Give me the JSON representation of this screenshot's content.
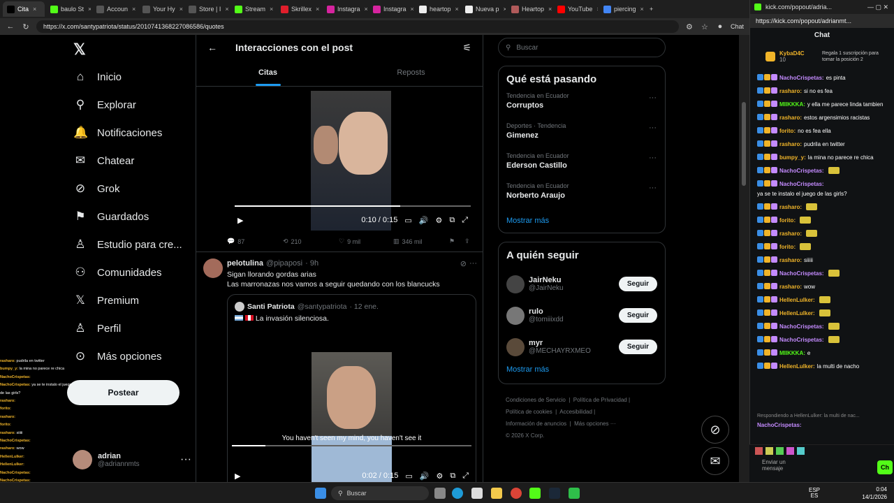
{
  "browser": {
    "tabs": [
      {
        "label": "Cita",
        "active": true,
        "color": "#000000"
      },
      {
        "label": "baulo St",
        "color": "#53fc18"
      },
      {
        "label": "Accoun",
        "color": "#555555"
      },
      {
        "label": "Your Hy",
        "color": "#555555"
      },
      {
        "label": "Store | I",
        "color": "#555555"
      },
      {
        "label": "Stream",
        "color": "#53fc18"
      },
      {
        "label": "Skrillex",
        "color": "#e01e2b"
      },
      {
        "label": "Instagra",
        "color": "#d6249f"
      },
      {
        "label": "Instagra",
        "color": "#d6249f"
      },
      {
        "label": "heartop",
        "color": "#eeeeee"
      },
      {
        "label": "Nueva p",
        "color": "#eeeeee"
      },
      {
        "label": "Heartop",
        "color": "#b05a5a"
      },
      {
        "label": "YouTube",
        "color": "#ff0000"
      },
      {
        "label": "piercing",
        "color": "#4285f4"
      }
    ],
    "url": "https://x.com/santypatriota/status/2010741368227086586/quotes",
    "profile_label": "Chat"
  },
  "x": {
    "nav": [
      {
        "label": "Inicio",
        "icon": "home-icon",
        "glyph": "⌂"
      },
      {
        "label": "Explorar",
        "icon": "search-icon",
        "glyph": "⚲"
      },
      {
        "label": "Notificaciones",
        "icon": "bell-icon",
        "glyph": "🔔"
      },
      {
        "label": "Chatear",
        "icon": "mail-icon",
        "glyph": "✉"
      },
      {
        "label": "Grok",
        "icon": "grok-icon",
        "glyph": "⊘"
      },
      {
        "label": "Guardados",
        "icon": "bookmark-icon",
        "glyph": "⚑"
      },
      {
        "label": "Estudio para cre...",
        "icon": "studio-icon",
        "glyph": "♙"
      },
      {
        "label": "Comunidades",
        "icon": "communities-icon",
        "glyph": "⚇"
      },
      {
        "label": "Premium",
        "icon": "premium-icon",
        "glyph": "𝕏"
      },
      {
        "label": "Perfil",
        "icon": "person-icon",
        "glyph": "♙"
      },
      {
        "label": "Más opciones",
        "icon": "more-icon",
        "glyph": "⊙"
      }
    ],
    "post_button": "Postear",
    "user": {
      "name": "adrian",
      "handle": "@adriannmts"
    },
    "header_title": "Interacciones con el post",
    "tabs": [
      "Citas",
      "Reposts"
    ],
    "video1": {
      "time": "0:10 / 0:15",
      "progress": 0.7
    },
    "post1_actions": {
      "replies": "87",
      "reposts": "210",
      "likes": "9 mil",
      "views": "346 mil"
    },
    "post2": {
      "name": "pelotulina",
      "handle": "@pipaposi",
      "age": "· 9h",
      "line1": "Sigan llorando gordas arias",
      "line2": "Las marronazas nos vamos a seguir quedando con los blancucks",
      "quoted": {
        "name": "Santi Patriota",
        "handle": "@santypatriota",
        "date": "· 12 ene.",
        "text": "La invasión silenciosa."
      },
      "subtitle": "You haven't seen my mind, you haven't see it",
      "video_time": "0:02 / 0:15",
      "progress": 0.14
    },
    "search_placeholder": "Buscar",
    "trends_title": "Qué está pasando",
    "trends": [
      {
        "context": "Tendencia en Ecuador",
        "name": "Corruptos"
      },
      {
        "context": "Deportes · Tendencia",
        "name": "Gimenez"
      },
      {
        "context": "Tendencia en Ecuador",
        "name": "Ederson Castillo"
      },
      {
        "context": "Tendencia en Ecuador",
        "name": "Norberto Araujo"
      }
    ],
    "show_more": "Mostrar más",
    "follow_title": "A quién seguir",
    "follow": [
      {
        "name": "JairNeku",
        "handle": "@JairNeku",
        "btn": "Seguir"
      },
      {
        "name": "rulo",
        "handle": "@tomiiixdd",
        "btn": "Seguir"
      },
      {
        "name": "myr",
        "handle": "@MECHAYRXMEO",
        "btn": "Seguir"
      }
    ],
    "footer": [
      "Condiciones de Servicio",
      "Política de Privacidad",
      "Política de cookies",
      "Accesibilidad",
      "Información de anuncios",
      "Más opciones ···",
      "© 2026 X Corp."
    ]
  },
  "overlay_chat": [
    {
      "user": "rasharo:",
      "text": "pudrila en twitter"
    },
    {
      "user": "bumpy_y:",
      "text": "la mina no parece re chica"
    },
    {
      "user": "NachoCrispetas:",
      "text": ""
    },
    {
      "user": "NachoCrispetas:",
      "text": "ya se te instalo el juego de las girls?"
    },
    {
      "user": "rasharo:",
      "text": ""
    },
    {
      "user": "forito:",
      "text": ""
    },
    {
      "user": "rasharo:",
      "text": ""
    },
    {
      "user": "forito:",
      "text": ""
    },
    {
      "user": "rasharo:",
      "text": "siiiii"
    },
    {
      "user": "NachoCrispetas:",
      "text": ""
    },
    {
      "user": "rasharo:",
      "text": "wow"
    },
    {
      "user": "HellenLulker:",
      "text": ""
    },
    {
      "user": "HellenLulker:",
      "text": ""
    },
    {
      "user": "NachoCrispetas:",
      "text": ""
    },
    {
      "user": "NachoCrispetas:",
      "text": ""
    },
    {
      "user": "MIIKKKA:",
      "text": "e"
    },
    {
      "user": "HellenLulker:",
      "text": "la multi de nacho"
    }
  ],
  "popout": {
    "url": "https://kick.com/popout/adrianmt...",
    "tab_label": "kick.com/popout/adria...",
    "title": "Chat",
    "pinned_user": "KybaD4C",
    "pinned_count": "10",
    "pinned_text": "Regala 1 suscripción para tomar la posición 2",
    "messages": [
      {
        "user": "NachoCrispetas:",
        "text": "es pinta",
        "color": "#c48bff"
      },
      {
        "user": "rasharo:",
        "text": "si no es fea",
        "color": "#f0b429"
      },
      {
        "user": "MIIKKKA:",
        "text": "y ella me parece linda tambien",
        "color": "#53fc18"
      },
      {
        "user": "rasharo:",
        "text": "estos argensimios racistas",
        "color": "#f0b429"
      },
      {
        "user": "forito:",
        "text": "no es fea ella",
        "color": "#f0b429"
      },
      {
        "user": "rasharo:",
        "text": "pudrila en twitter",
        "color": "#f0b429"
      },
      {
        "user": "bumpy_y:",
        "text": "la mina no parece re chica",
        "color": "#f0b429"
      },
      {
        "user": "NachoCrispetas:",
        "text": "",
        "color": "#c48bff"
      },
      {
        "user": "NachoCrispetas:",
        "text": "ya se te instalo el juego de las girls?",
        "color": "#c48bff"
      },
      {
        "user": "rasharo:",
        "text": "",
        "color": "#f0b429"
      },
      {
        "user": "forito:",
        "text": "",
        "color": "#f0b429"
      },
      {
        "user": "rasharo:",
        "text": "",
        "color": "#f0b429"
      },
      {
        "user": "forito:",
        "text": "",
        "color": "#f0b429"
      },
      {
        "user": "rasharo:",
        "text": "siiiii",
        "color": "#f0b429"
      },
      {
        "user": "NachoCrispetas:",
        "text": "",
        "color": "#c48bff"
      },
      {
        "user": "rasharo:",
        "text": "wow",
        "color": "#f0b429"
      },
      {
        "user": "HellenLulker:",
        "text": "",
        "color": "#f0b429"
      },
      {
        "user": "HellenLulker:",
        "text": "",
        "color": "#f0b429"
      },
      {
        "user": "NachoCrispetas:",
        "text": "",
        "color": "#c48bff"
      },
      {
        "user": "NachoCrispetas:",
        "text": "",
        "color": "#c48bff"
      },
      {
        "user": "MIIKKKA:",
        "text": "e",
        "color": "#53fc18"
      },
      {
        "user": "HellenLulker:",
        "text": "la multi de nacho",
        "color": "#f0b429"
      }
    ],
    "reply_note": "Respondiendo a HellenLulker: la multi de nac...",
    "last": {
      "user": "NachoCrispetas:",
      "text": ""
    },
    "send_placeholder": "Enviar un mensaje",
    "chat_button": "Ch"
  },
  "taskbar": {
    "search": "Buscar",
    "lang": "ESP",
    "region": "ES",
    "time": "0:04",
    "date": "14/1/2026"
  }
}
